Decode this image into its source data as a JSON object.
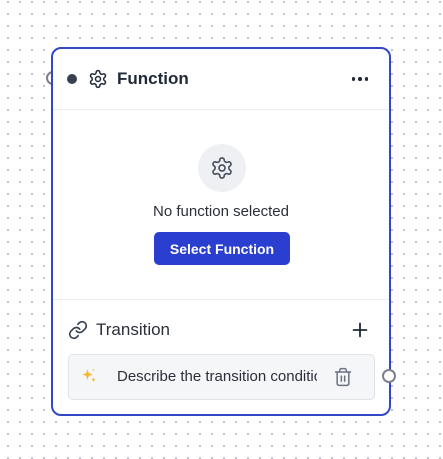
{
  "node": {
    "title": "Function",
    "header_icon": "gear-icon",
    "menu_icon": "more-horizontal-icon"
  },
  "empty_state": {
    "icon": "gear-icon",
    "message": "No function selected",
    "button_label": "Select Function"
  },
  "transition": {
    "icon": "link-icon",
    "label": "Transition",
    "add_icon": "plus-icon",
    "condition": {
      "icon": "sparkles-icon",
      "placeholder": "Describe the transition condition",
      "value": "",
      "delete_icon": "trash-icon"
    }
  },
  "colors": {
    "accent": "#2a3fcf",
    "border": "#3547c9",
    "status_dot": "#374151"
  }
}
